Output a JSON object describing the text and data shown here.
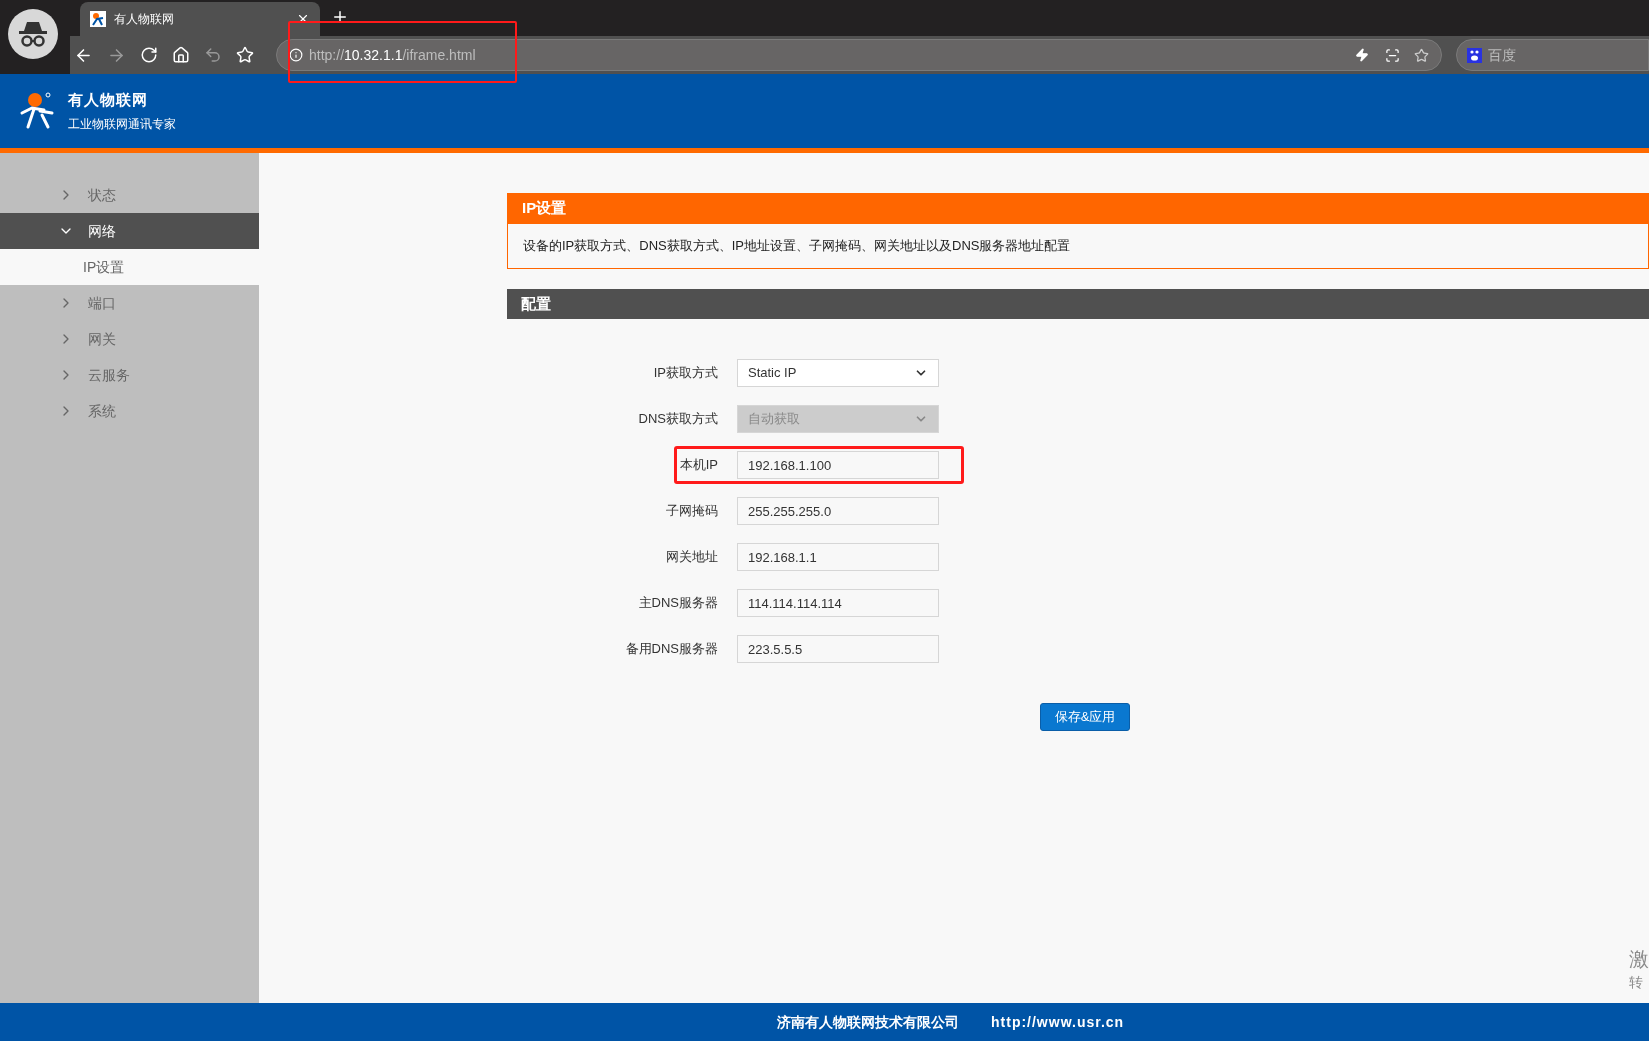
{
  "browser": {
    "tab_title": "有人物联网",
    "url_scheme": "http://",
    "url_host": "10.32.1.1",
    "url_path": "/iframe.html",
    "url_highlighted": true,
    "search_engine": "百度"
  },
  "header": {
    "title": "有人物联网",
    "subtitle": "工业物联网通讯专家"
  },
  "sidebar": {
    "items": [
      {
        "label": "状态",
        "expanded": false
      },
      {
        "label": "网络",
        "expanded": true,
        "children": [
          {
            "label": "IP设置",
            "selected": true
          }
        ]
      },
      {
        "label": "端口",
        "expanded": false
      },
      {
        "label": "网关",
        "expanded": false
      },
      {
        "label": "云服务",
        "expanded": false
      },
      {
        "label": "系统",
        "expanded": false
      }
    ]
  },
  "section": {
    "title": "IP设置",
    "description": "设备的IP获取方式、DNS获取方式、IP地址设置、子网掩码、网关地址以及DNS服务器地址配置"
  },
  "config": {
    "title": "配置",
    "fields": [
      {
        "kind": "select",
        "label": "IP获取方式",
        "value": "Static IP",
        "disabled": false,
        "highlighted": false
      },
      {
        "kind": "select",
        "label": "DNS获取方式",
        "value": "自动获取",
        "disabled": true,
        "highlighted": false
      },
      {
        "kind": "input",
        "label": "本机IP",
        "value": "192.168.1.100",
        "disabled": false,
        "highlighted": true
      },
      {
        "kind": "input",
        "label": "子网掩码",
        "value": "255.255.255.0",
        "disabled": false,
        "highlighted": false
      },
      {
        "kind": "input",
        "label": "网关地址",
        "value": "192.168.1.1",
        "disabled": false,
        "highlighted": false
      },
      {
        "kind": "input",
        "label": "主DNS服务器",
        "value": "114.114.114.114",
        "disabled": false,
        "highlighted": false
      },
      {
        "kind": "input",
        "label": "备用DNS服务器",
        "value": "223.5.5.5",
        "disabled": false,
        "highlighted": false
      }
    ],
    "button": "保存&应用"
  },
  "os_overlay": [
    "激",
    "转"
  ],
  "footer": {
    "company": "济南有人物联网技术有限公司",
    "url": "http://www.usr.cn"
  }
}
